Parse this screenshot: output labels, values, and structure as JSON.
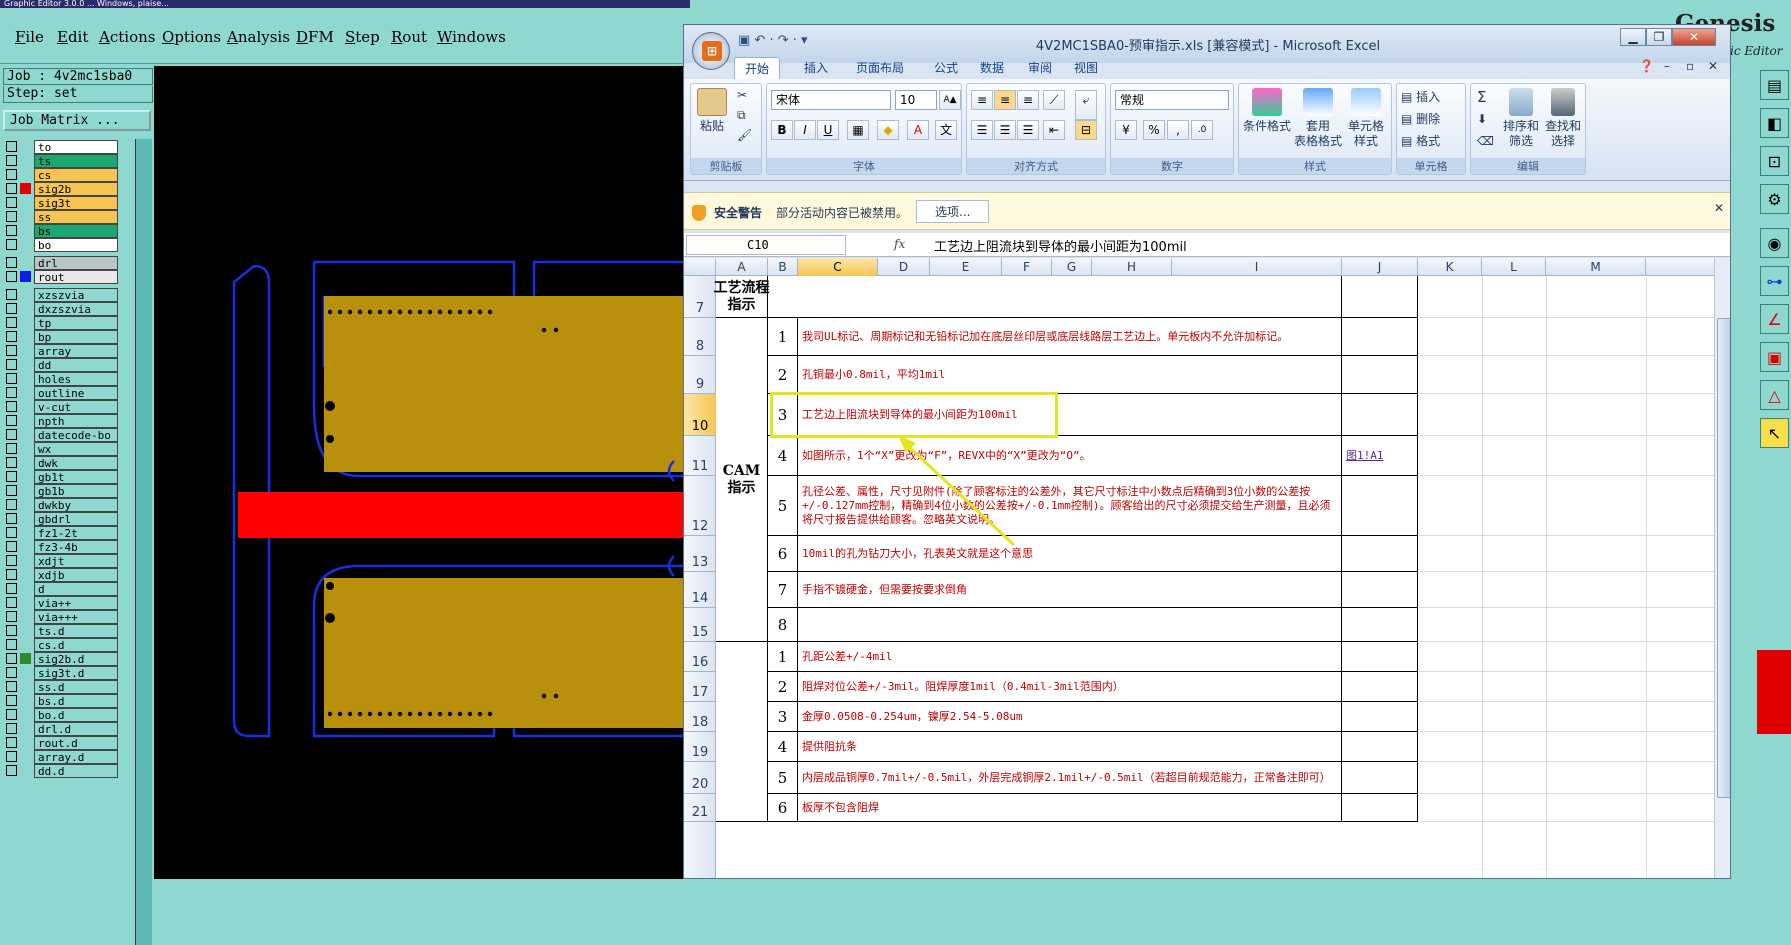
{
  "genesis": {
    "title_fragment": "Graphic Editor 3.0.0 ... Windows, plaise...",
    "menu": [
      "File",
      "Edit",
      "Actions",
      "Options",
      "Analysis",
      "DFM",
      "Step",
      "Rout",
      "Windows"
    ],
    "job_line": "Job : 4v2mc1sba0",
    "step_line": "Step: set",
    "job_matrix_button": "Job Matrix ...",
    "layers": [
      {
        "name": "to",
        "bg": "#ffffff",
        "sw": ""
      },
      {
        "name": "ts",
        "bg": "#1aa870",
        "sw": ""
      },
      {
        "name": "cs",
        "bg": "#f5c452",
        "sw": ""
      },
      {
        "name": "sig2b",
        "bg": "#f5c452",
        "sw": "#e00000"
      },
      {
        "name": "sig3t",
        "bg": "#f5c452",
        "sw": ""
      },
      {
        "name": "ss",
        "bg": "#f5c452",
        "sw": ""
      },
      {
        "name": "bs",
        "bg": "#1aa870",
        "sw": ""
      },
      {
        "name": "bo",
        "bg": "#ffffff",
        "sw": ""
      },
      {
        "name": "drl",
        "bg": "#b8c6c8",
        "sw": ""
      },
      {
        "name": "rout",
        "bg": "#e8e8e8",
        "sw": "#1020e0"
      },
      {
        "name": "xzszvia",
        "bg": "#8fd8d0",
        "sw": ""
      },
      {
        "name": "dxzszvia",
        "bg": "#8fd8d0",
        "sw": ""
      },
      {
        "name": "tp",
        "bg": "#8fd8d0",
        "sw": ""
      },
      {
        "name": "bp",
        "bg": "#8fd8d0",
        "sw": ""
      },
      {
        "name": "array",
        "bg": "#8fd8d0",
        "sw": ""
      },
      {
        "name": "dd",
        "bg": "#8fd8d0",
        "sw": ""
      },
      {
        "name": "holes",
        "bg": "#8fd8d0",
        "sw": ""
      },
      {
        "name": "outline",
        "bg": "#8fd8d0",
        "sw": ""
      },
      {
        "name": "v-cut",
        "bg": "#8fd8d0",
        "sw": ""
      },
      {
        "name": "npth",
        "bg": "#8fd8d0",
        "sw": ""
      },
      {
        "name": "datecode-bo",
        "bg": "#8fd8d0",
        "sw": ""
      },
      {
        "name": "wx",
        "bg": "#8fd8d0",
        "sw": ""
      },
      {
        "name": "dwk",
        "bg": "#8fd8d0",
        "sw": ""
      },
      {
        "name": "gb1t",
        "bg": "#8fd8d0",
        "sw": ""
      },
      {
        "name": "gb1b",
        "bg": "#8fd8d0",
        "sw": ""
      },
      {
        "name": "dwkby",
        "bg": "#8fd8d0",
        "sw": ""
      },
      {
        "name": "gbdrl",
        "bg": "#8fd8d0",
        "sw": ""
      },
      {
        "name": "fz1-2t",
        "bg": "#8fd8d0",
        "sw": ""
      },
      {
        "name": "fz3-4b",
        "bg": "#8fd8d0",
        "sw": ""
      },
      {
        "name": "xdjt",
        "bg": "#8fd8d0",
        "sw": ""
      },
      {
        "name": "xdjb",
        "bg": "#8fd8d0",
        "sw": ""
      },
      {
        "name": "d",
        "bg": "#8fd8d0",
        "sw": ""
      },
      {
        "name": "via++",
        "bg": "#8fd8d0",
        "sw": ""
      },
      {
        "name": "via+++",
        "bg": "#8fd8d0",
        "sw": ""
      },
      {
        "name": "ts.d",
        "bg": "#8fd8d0",
        "sw": ""
      },
      {
        "name": "cs.d",
        "bg": "#8fd8d0",
        "sw": ""
      },
      {
        "name": "sig2b.d",
        "bg": "#8fd8d0",
        "sw": "#2e8b2e"
      },
      {
        "name": "sig3t.d",
        "bg": "#8fd8d0",
        "sw": ""
      },
      {
        "name": "ss.d",
        "bg": "#8fd8d0",
        "sw": ""
      },
      {
        "name": "bs.d",
        "bg": "#8fd8d0",
        "sw": ""
      },
      {
        "name": "bo.d",
        "bg": "#8fd8d0",
        "sw": ""
      },
      {
        "name": "drl.d",
        "bg": "#8fd8d0",
        "sw": ""
      },
      {
        "name": "rout.d",
        "bg": "#8fd8d0",
        "sw": ""
      },
      {
        "name": "array.d",
        "bg": "#8fd8d0",
        "sw": ""
      },
      {
        "name": "dd.d",
        "bg": "#8fd8d0",
        "sw": ""
      }
    ],
    "logo": "Genesis 20",
    "logo_sub": "ic Editor"
  },
  "excel": {
    "qat": "▣ ↶ · ↷ · ▾",
    "title": "4V2MC1SBA0-预审指示.xls  [兼容模式] - Microsoft Excel",
    "help_faded": "Help",
    "tabs": [
      "开始",
      "插入",
      "页面布局",
      "公式",
      "数据",
      "审阅",
      "视图"
    ],
    "ribbon": {
      "paste": "粘贴",
      "clipboard": "剪贴板",
      "font_name": "宋体",
      "font_size": "10",
      "font": "字体",
      "align": "对齐方式",
      "numfmt": "常规",
      "number": "数字",
      "cond_fmt": "条件格式",
      "table_fmt": "套用\n表格格式",
      "cell_style": "单元格\n样式",
      "styles": "样式",
      "insert": "插入",
      "delete": "删除",
      "format": "格式",
      "cells": "单元格",
      "sort": "排序和\n筛选",
      "find": "查找和\n选择",
      "editing": "编辑",
      "bold": "B",
      "italic": "I",
      "underline": "U",
      "incfont": "A▲",
      "decfont": "A▼",
      "percent": "%",
      "comma": ",",
      "sigma": "Σ"
    },
    "security": {
      "label": "安全警告",
      "text": "部分活动内容已被禁用。",
      "button": "选项..."
    },
    "namebox": "C10",
    "fx": "fx",
    "formula": "工艺边上阻流块到导体的最小间距为100mil",
    "columns": [
      "A",
      "B",
      "C",
      "D",
      "E",
      "F",
      "G",
      "H",
      "I",
      "J",
      "K",
      "L",
      "M"
    ],
    "rows": [
      {
        "n": "7",
        "num": "",
        "text": ""
      },
      {
        "n": "8",
        "num": "1",
        "text": "我司UL标记、周期标记和无铅标记加在底层丝印层或底层线路层工艺边上。单元板内不允许加标记。"
      },
      {
        "n": "9",
        "num": "2",
        "text": "孔铜最小0.8mil，平均1mil"
      },
      {
        "n": "10",
        "num": "3",
        "text": "工艺边上阻流块到导体的最小间距为100mil"
      },
      {
        "n": "11",
        "num": "4",
        "text": "如图所示，1个“X”更改为“F”，REVX中的“X”更改为“O”。"
      },
      {
        "n": "12",
        "num": "5",
        "text": "孔径公差、属性，尺寸见附件(除了顾客标注的公差外，其它尺寸标注中小数点后精确到3位小数的公差按+/-0.127mm控制，精确到4位小数的公差按+/-0.1mm控制)。顾客给出的尺寸必须提交给生产测量，且必须将尺寸报告提供给顾客。忽略英文说明。"
      },
      {
        "n": "13",
        "num": "6",
        "text": "10mil的孔为钻刀大小，孔表英文就是这个意思"
      },
      {
        "n": "14",
        "num": "7",
        "text": "手指不镀硬金，但需要按要求倒角"
      },
      {
        "n": "15",
        "num": "8",
        "text": ""
      },
      {
        "n": "16",
        "num": "1",
        "text": "孔距公差+/-4mil"
      },
      {
        "n": "17",
        "num": "2",
        "text": "阻焊对位公差+/-3mil。阻焊厚度1mil（0.4mil-3mil范围内）"
      },
      {
        "n": "18",
        "num": "3",
        "text": "金厚0.0508-0.254um，镍厚2.54-5.08um"
      },
      {
        "n": "19",
        "num": "4",
        "text": "提供阻抗条"
      },
      {
        "n": "20",
        "num": "5",
        "text": "内层成品铜厚0.7mil+/-0.5mil，外层完成铜厚2.1mil+/-0.5mil（若超目前规范能力，正常备注即可）"
      },
      {
        "n": "21",
        "num": "6",
        "text": "板厚不包含阻焊"
      }
    ],
    "a7_label": "工艺流程\n指示",
    "cam_label": "CAM\n指示",
    "link_text": "图1!A1"
  }
}
